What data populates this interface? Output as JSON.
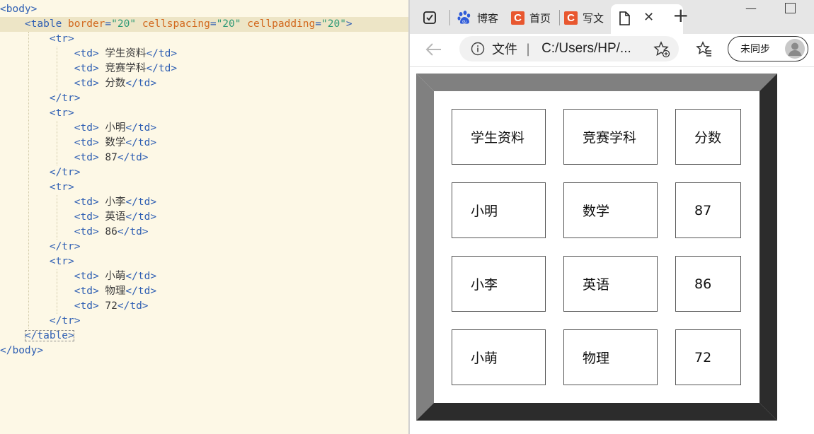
{
  "editor": {
    "lines": [
      [
        {
          "c": "tg",
          "t": "<body>"
        }
      ],
      [
        {
          "c": "tx",
          "t": "    "
        },
        {
          "c": "tg",
          "t": "<table "
        },
        {
          "c": "at",
          "t": "border"
        },
        {
          "c": "tg",
          "t": "="
        },
        {
          "c": "st",
          "t": "\"20\""
        },
        {
          "c": "tx",
          "t": " "
        },
        {
          "c": "at",
          "t": "cellspacing"
        },
        {
          "c": "tg",
          "t": "="
        },
        {
          "c": "st",
          "t": "\"20\""
        },
        {
          "c": "tx",
          "t": " "
        },
        {
          "c": "at",
          "t": "cellpadding"
        },
        {
          "c": "tg",
          "t": "="
        },
        {
          "c": "st",
          "t": "\"20\""
        },
        {
          "c": "tg",
          "t": ">"
        }
      ],
      [
        {
          "c": "tx",
          "t": "        "
        },
        {
          "c": "tg",
          "t": "<tr>"
        }
      ],
      [
        {
          "c": "tx",
          "t": "            "
        },
        {
          "c": "tg",
          "t": "<td>"
        },
        {
          "c": "tx",
          "t": " 学生资料"
        },
        {
          "c": "tg",
          "t": "</td>"
        }
      ],
      [
        {
          "c": "tx",
          "t": "            "
        },
        {
          "c": "tg",
          "t": "<td>"
        },
        {
          "c": "tx",
          "t": " 竞赛学科"
        },
        {
          "c": "tg",
          "t": "</td>"
        }
      ],
      [
        {
          "c": "tx",
          "t": "            "
        },
        {
          "c": "tg",
          "t": "<td>"
        },
        {
          "c": "tx",
          "t": " 分数"
        },
        {
          "c": "tg",
          "t": "</td>"
        }
      ],
      [
        {
          "c": "tx",
          "t": "        "
        },
        {
          "c": "tg",
          "t": "</tr>"
        }
      ],
      [
        {
          "c": "tx",
          "t": "        "
        },
        {
          "c": "tg",
          "t": "<tr>"
        }
      ],
      [
        {
          "c": "tx",
          "t": "            "
        },
        {
          "c": "tg",
          "t": "<td>"
        },
        {
          "c": "tx",
          "t": " 小明"
        },
        {
          "c": "tg",
          "t": "</td>"
        }
      ],
      [
        {
          "c": "tx",
          "t": "            "
        },
        {
          "c": "tg",
          "t": "<td>"
        },
        {
          "c": "tx",
          "t": " 数学"
        },
        {
          "c": "tg",
          "t": "</td>"
        }
      ],
      [
        {
          "c": "tx",
          "t": "            "
        },
        {
          "c": "tg",
          "t": "<td>"
        },
        {
          "c": "tx",
          "t": " 87"
        },
        {
          "c": "tg",
          "t": "</td>"
        }
      ],
      [
        {
          "c": "tx",
          "t": "        "
        },
        {
          "c": "tg",
          "t": "</tr>"
        }
      ],
      [
        {
          "c": "tx",
          "t": "        "
        },
        {
          "c": "tg",
          "t": "<tr>"
        }
      ],
      [
        {
          "c": "tx",
          "t": "            "
        },
        {
          "c": "tg",
          "t": "<td>"
        },
        {
          "c": "tx",
          "t": " 小李"
        },
        {
          "c": "tg",
          "t": "</td>"
        }
      ],
      [
        {
          "c": "tx",
          "t": "            "
        },
        {
          "c": "tg",
          "t": "<td>"
        },
        {
          "c": "tx",
          "t": " 英语"
        },
        {
          "c": "tg",
          "t": "</td>"
        }
      ],
      [
        {
          "c": "tx",
          "t": "            "
        },
        {
          "c": "tg",
          "t": "<td>"
        },
        {
          "c": "tx",
          "t": " 86"
        },
        {
          "c": "tg",
          "t": "</td>"
        }
      ],
      [
        {
          "c": "tx",
          "t": "        "
        },
        {
          "c": "tg",
          "t": "</tr>"
        }
      ],
      [
        {
          "c": "tx",
          "t": "        "
        },
        {
          "c": "tg",
          "t": "<tr>"
        }
      ],
      [
        {
          "c": "tx",
          "t": "            "
        },
        {
          "c": "tg",
          "t": "<td>"
        },
        {
          "c": "tx",
          "t": " 小萌"
        },
        {
          "c": "tg",
          "t": "</td>"
        }
      ],
      [
        {
          "c": "tx",
          "t": "            "
        },
        {
          "c": "tg",
          "t": "<td>"
        },
        {
          "c": "tx",
          "t": " 物理"
        },
        {
          "c": "tg",
          "t": "</td>"
        }
      ],
      [
        {
          "c": "tx",
          "t": "            "
        },
        {
          "c": "tg",
          "t": "<td>"
        },
        {
          "c": "tx",
          "t": " 72"
        },
        {
          "c": "tg",
          "t": "</td>"
        }
      ],
      [
        {
          "c": "tx",
          "t": "        "
        },
        {
          "c": "tg",
          "t": "</tr>"
        }
      ],
      [
        {
          "c": "tx",
          "t": "    "
        },
        {
          "c": "tg",
          "t": "</table>"
        }
      ],
      [
        {
          "c": "tg",
          "t": "</body>"
        }
      ]
    ],
    "highlighted_line": 1,
    "colors": {
      "tag": "#2f5fb3",
      "attribute": "#d2691e",
      "string": "#2e9a76",
      "text": "#3a3a3a",
      "background": "#fdf8e6"
    }
  },
  "browser": {
    "tabs": [
      {
        "label": "博客",
        "icon": "baidu-paw-icon"
      },
      {
        "label": "首页",
        "icon": "csdn-c-icon"
      },
      {
        "label": "写文",
        "icon": "csdn-c-icon"
      },
      {
        "label": "",
        "icon": "document-icon",
        "active": true
      }
    ],
    "new_tab_glyph": "+",
    "address": {
      "info_label": "文件",
      "url": "C:/Users/HP/..."
    },
    "profile_label": "未同步",
    "table": {
      "rows": [
        [
          "学生资料",
          "竞赛学科",
          "分数"
        ],
        [
          "小明",
          "数学",
          "87"
        ],
        [
          "小李",
          "英语",
          "86"
        ],
        [
          "小萌",
          "物理",
          "72"
        ]
      ]
    }
  }
}
